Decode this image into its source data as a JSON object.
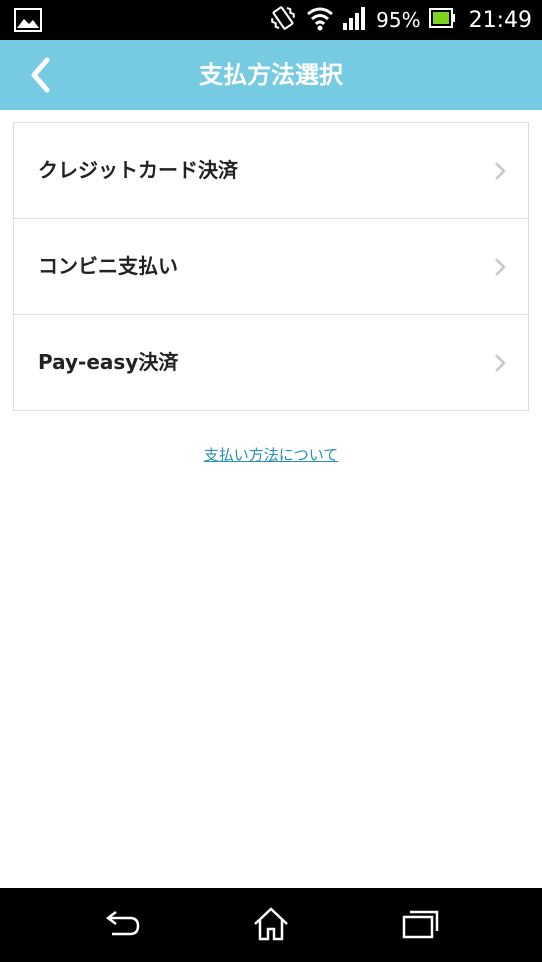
{
  "status_bar": {
    "battery_percent": "95%",
    "time": "21:49",
    "icons": [
      "image-notification-icon",
      "vibrate-icon",
      "wifi-icon",
      "signal-icon",
      "battery-icon"
    ]
  },
  "app_bar": {
    "title": "支払方法選択",
    "background_color": "#76cbe2"
  },
  "payment_methods": [
    {
      "label": "クレジットカード決済"
    },
    {
      "label": "コンビニ支払い"
    },
    {
      "label": "Pay-easy決済"
    }
  ],
  "about_link": {
    "label": "支払い方法について",
    "color": "#2a8fb0"
  },
  "nav_bar": {
    "icons": [
      "back-icon",
      "home-icon",
      "recent-apps-icon"
    ]
  }
}
